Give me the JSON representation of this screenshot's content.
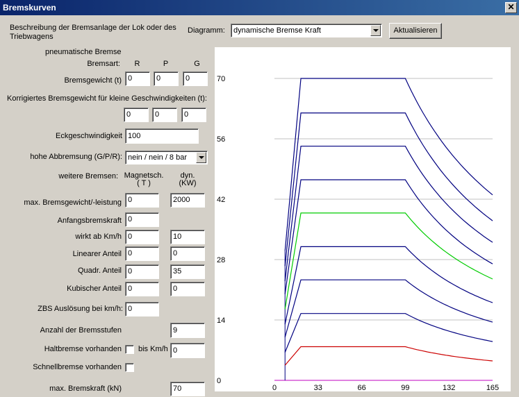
{
  "window": {
    "title": "Bremskurven"
  },
  "header": {
    "description_label": "Beschreibung der Bremsanlage der Lok oder des Triebwagens",
    "diagram_label": "Diagramm:",
    "diagram_value": "dynamische Bremse Kraft",
    "update_button": "Aktualisieren"
  },
  "pneumatic": {
    "heading": "pneumatische Bremse",
    "brake_type_label": "Bremsart:",
    "col_r": "R",
    "col_p": "P",
    "col_g": "G",
    "brake_weight_label": "Bremsgewicht (t)",
    "brake_weight_r": "0",
    "brake_weight_p": "0",
    "brake_weight_g": "0",
    "corrected_label": "Korrigiertes Bremsgewicht für kleine Geschwindigkeiten (t):",
    "corrected_r": "0",
    "corrected_p": "0",
    "corrected_g": "0",
    "corner_speed_label": "Eckgeschwindigkeit",
    "corner_speed_value": "100",
    "high_braking_label": "hohe Abbremsung (G/P/R):",
    "high_braking_value": "nein / nein / 8 bar"
  },
  "other": {
    "heading": "weitere Bremsen:",
    "col_magnet": "Magnetsch.\n( T )",
    "col_dyn": "dyn.\n(KW)",
    "max_label": "max. Bremsgewicht/-leistung",
    "max_magnet": "0",
    "max_dyn": "2000",
    "initial_label": "Anfangsbremskraft",
    "initial_value": "0",
    "from_speed_label": "wirkt ab Km/h",
    "from_speed_magnet": "0",
    "from_speed_dyn": "10",
    "linear_label": "Linearer Anteil",
    "linear_magnet": "0",
    "linear_dyn": "0",
    "quad_label": "Quadr. Anteil",
    "quad_magnet": "0",
    "quad_dyn": "35",
    "cubic_label": "Kubischer Anteil",
    "cubic_magnet": "0",
    "cubic_dyn": "0",
    "zbs_label": "ZBS Auslösung bei km/h:",
    "zbs_value": "0",
    "stages_label": "Anzahl der Bremsstufen",
    "stages_value": "9",
    "hold_label": "Haltbremse vorhanden",
    "hold_until_label": "bis Km/h",
    "hold_until_value": "0",
    "emergency_label": "Schnellbremse vorhanden",
    "max_force_label": "max. Bremskraft (kN)",
    "max_force_value": "70"
  },
  "chart_data": {
    "type": "line",
    "xlim": [
      0,
      165
    ],
    "ylim": [
      0,
      70
    ],
    "x_ticks": [
      "0",
      "33",
      "66",
      "99",
      "132",
      "165"
    ],
    "y_ticks": [
      "0",
      "14",
      "28",
      "42",
      "56",
      "70"
    ],
    "series": [
      {
        "color": "#cc0000",
        "x": [
          8,
          20,
          99,
          165
        ],
        "y": [
          3.5,
          7.8,
          7.8,
          4.5
        ]
      },
      {
        "color": "#000080",
        "x": [
          8,
          20,
          99,
          165
        ],
        "y": [
          6.5,
          15.5,
          15.5,
          9
        ]
      },
      {
        "color": "#000080",
        "x": [
          8,
          20,
          99,
          165
        ],
        "y": [
          10,
          23.3,
          23.3,
          13.5
        ]
      },
      {
        "color": "#000080",
        "x": [
          8,
          20,
          99,
          165
        ],
        "y": [
          13,
          31,
          31,
          18
        ]
      },
      {
        "color": "#00cc00",
        "x": [
          8,
          20,
          99,
          165
        ],
        "y": [
          16.5,
          38.8,
          38.8,
          23.5
        ]
      },
      {
        "color": "#000080",
        "x": [
          8,
          20,
          99,
          165
        ],
        "y": [
          20,
          46.5,
          46.5,
          27
        ]
      },
      {
        "color": "#000080",
        "x": [
          8,
          20,
          99,
          165
        ],
        "y": [
          23,
          54.3,
          54.3,
          32
        ]
      },
      {
        "color": "#000080",
        "x": [
          8,
          20,
          99,
          165
        ],
        "y": [
          26.5,
          62,
          62,
          37
        ]
      },
      {
        "color": "#000080",
        "x": [
          8,
          20,
          99,
          165
        ],
        "y": [
          30,
          70,
          70,
          43
        ]
      }
    ]
  }
}
